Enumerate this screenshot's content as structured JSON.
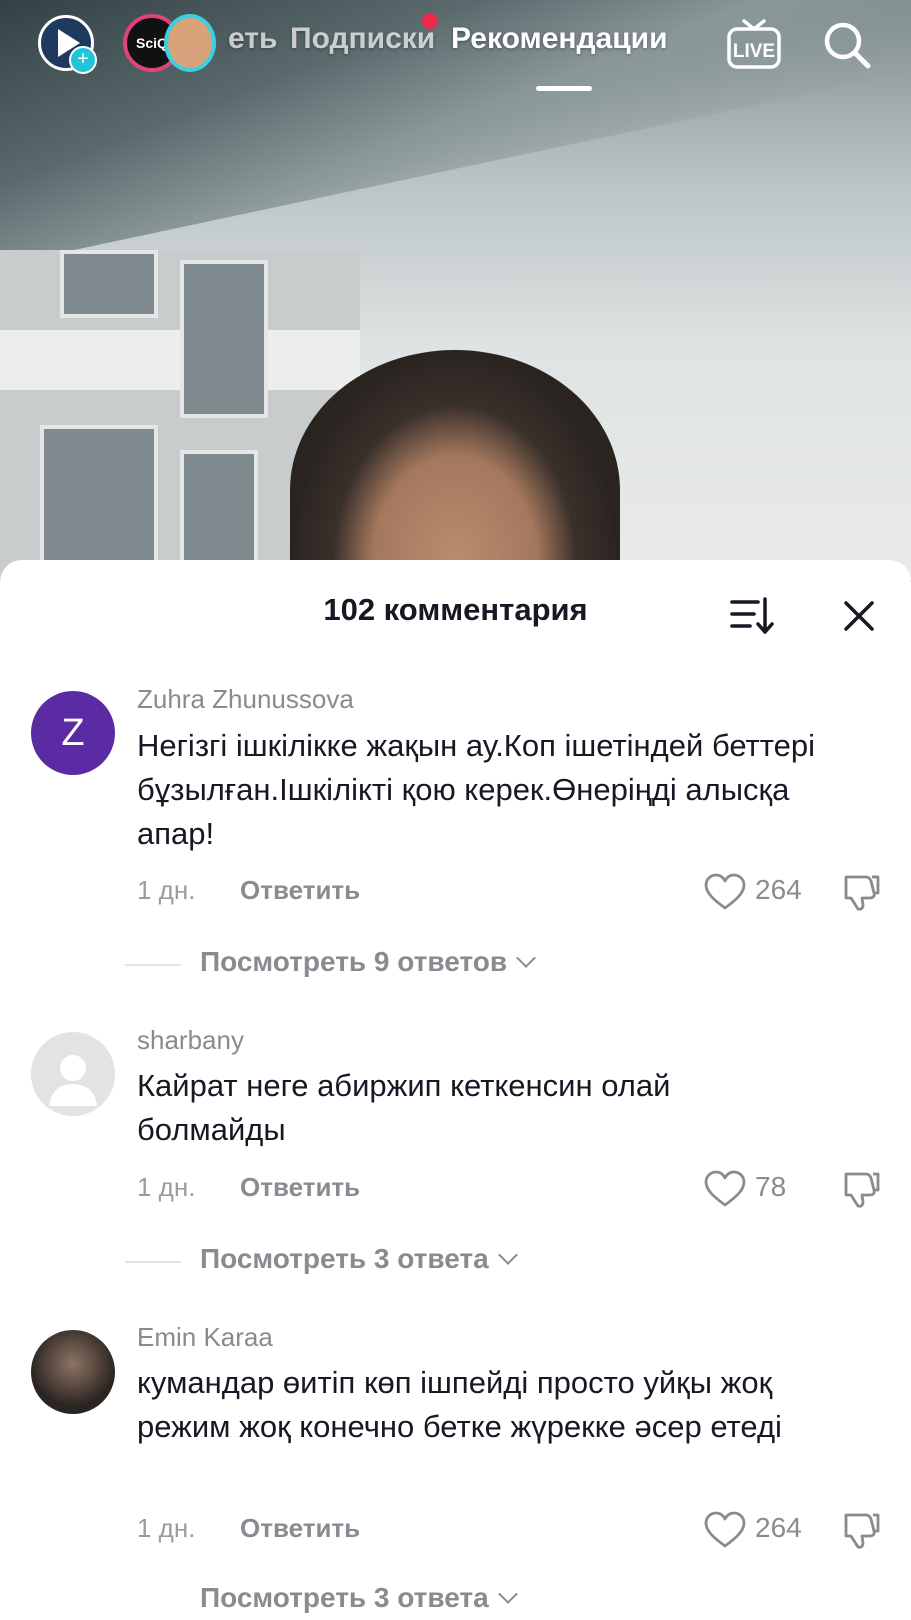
{
  "topbar": {
    "tabs": [
      "еть",
      "Подписки",
      "Рекомендации"
    ],
    "active_tab": "Рекомендации",
    "avatar1_text": "SciQ",
    "live_label": "LIVE"
  },
  "comments_sheet": {
    "title": "102 комментария",
    "comments": [
      {
        "author": "Zuhra Zhunussova",
        "avatar_letter": "Z",
        "avatar_color": "#5b2ba3",
        "text": "Негізгі ішкілікке жақын ау.Коп ішетіндей беттері бұзылған.Ішкілікті қою керек.Өнеріңді алысқа апар!",
        "time": "1 дн.",
        "reply_label": "Ответить",
        "likes": "264",
        "view_replies": "Посмотреть 9 ответов"
      },
      {
        "author": "sharbany",
        "avatar_letter": "",
        "avatar_color": "#e3e3e5",
        "text": "Кайрат неге абиржип кеткенсин олай болмайды",
        "time": "1 дн.",
        "reply_label": "Ответить",
        "likes": "78",
        "view_replies": "Посмотреть 3 ответа"
      },
      {
        "author": "Emin Karaa",
        "avatar_letter": "",
        "avatar_color": "#3a3a3a",
        "text": "кумандар өитіп көп ішпейді просто уйқы жоқ режим жоқ конечно бетке жүрекке әсер етеді",
        "time": "1 дн.",
        "reply_label": "Ответить",
        "likes": "264",
        "view_replies": "Посмотреть 3 ответа"
      }
    ]
  }
}
